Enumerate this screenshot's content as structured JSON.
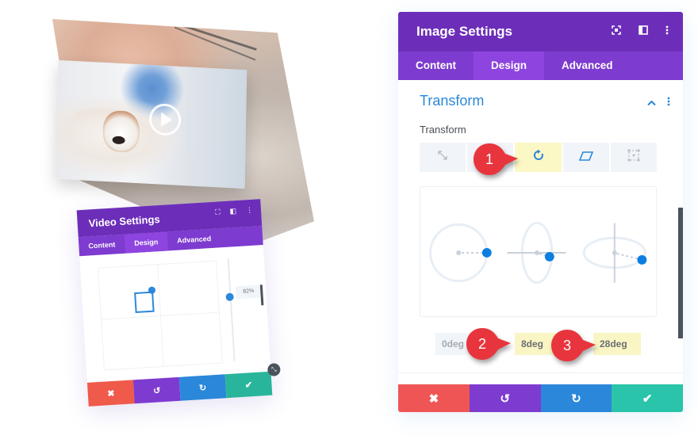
{
  "image_settings_panel": {
    "title": "Image Settings",
    "header_icons": [
      "expand-icon",
      "split-view-icon",
      "more-options-icon"
    ],
    "tabs": [
      {
        "label": "Content",
        "active": false
      },
      {
        "label": "Design",
        "active": true
      },
      {
        "label": "Advanced",
        "active": false
      }
    ],
    "section": {
      "title": "Transform",
      "collapse_icon": "chevron-up-icon",
      "menu_icon": "more-options-icon"
    },
    "field_label": "Transform",
    "transform_tabs": [
      {
        "icon": "scale-icon",
        "active": false
      },
      {
        "icon": "translate-icon",
        "active": false
      },
      {
        "icon": "rotate-icon",
        "active": true
      },
      {
        "icon": "skew-icon",
        "active": false
      },
      {
        "icon": "origin-icon",
        "active": false
      }
    ],
    "rotate_values": {
      "x": "0deg",
      "y": "8deg",
      "z": "28deg"
    },
    "actions": [
      {
        "name": "discard",
        "icon": "✖",
        "color": "#ef5555"
      },
      {
        "name": "undo",
        "icon": "↺",
        "color": "#7e3bd0"
      },
      {
        "name": "redo",
        "icon": "↻",
        "color": "#2b87da"
      },
      {
        "name": "save",
        "icon": "✔",
        "color": "#29c4a9"
      }
    ]
  },
  "callouts": [
    {
      "number": "1"
    },
    {
      "number": "2"
    },
    {
      "number": "3"
    }
  ],
  "video_settings_panel": {
    "title": "Video Settings",
    "header_icons": [
      "expand-icon",
      "split-view-icon",
      "more-options-icon"
    ],
    "tabs": [
      {
        "label": "Content",
        "active": false
      },
      {
        "label": "Design",
        "active": true
      },
      {
        "label": "Advanced",
        "active": false
      }
    ],
    "slider_value": "82%",
    "actions": [
      {
        "name": "discard",
        "icon": "✖",
        "color": "#ef5555"
      },
      {
        "name": "undo",
        "icon": "↺",
        "color": "#7e3bd0"
      },
      {
        "name": "redo",
        "icon": "↻",
        "color": "#2b87da"
      },
      {
        "name": "save",
        "icon": "✔",
        "color": "#29c4a9"
      }
    ]
  },
  "colors": {
    "header_purple": "#6c2eb9",
    "tab_purple": "#7d3bcf",
    "active_tab": "#8e45e0",
    "accent_blue": "#2b87da",
    "highlight_yellow": "#fcf8c5",
    "callout_red": "#e8353d"
  }
}
